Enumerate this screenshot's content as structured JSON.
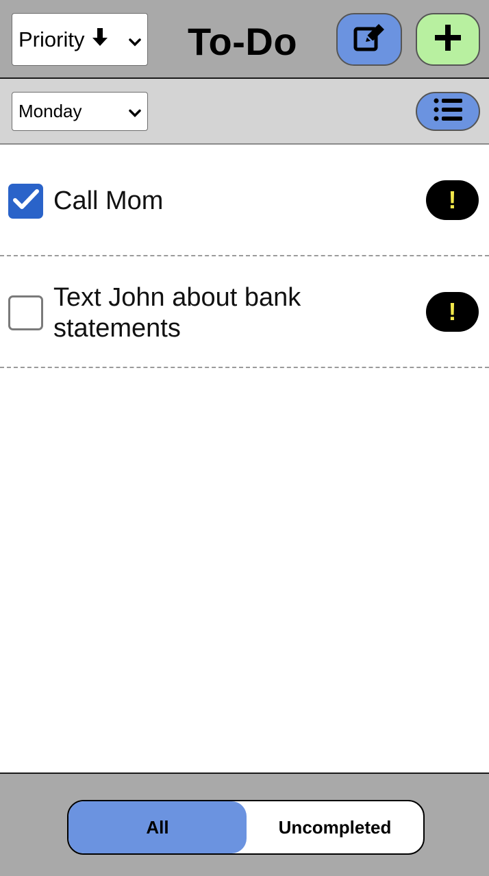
{
  "header": {
    "sort_select": {
      "selected": "Priority",
      "arrow": "🡇"
    },
    "title": "To-Do",
    "edit_icon": "edit-icon",
    "add_icon": "plus-icon"
  },
  "subheader": {
    "day_select": {
      "selected": "Monday"
    },
    "list_icon": "list-icon"
  },
  "tasks": [
    {
      "label": "Call Mom",
      "completed": true,
      "priority": "!"
    },
    {
      "label": "Text John about bank statements",
      "completed": false,
      "priority": "!"
    }
  ],
  "footer": {
    "filters": [
      "All",
      "Uncompleted"
    ],
    "active_filter": "All"
  },
  "colors": {
    "header_bg": "#a9a9a9",
    "accent_blue": "#6b93e0",
    "add_green": "#b8f0a0",
    "checkbox_blue": "#2a63c9",
    "priority_yellow": "#f2e84b"
  }
}
